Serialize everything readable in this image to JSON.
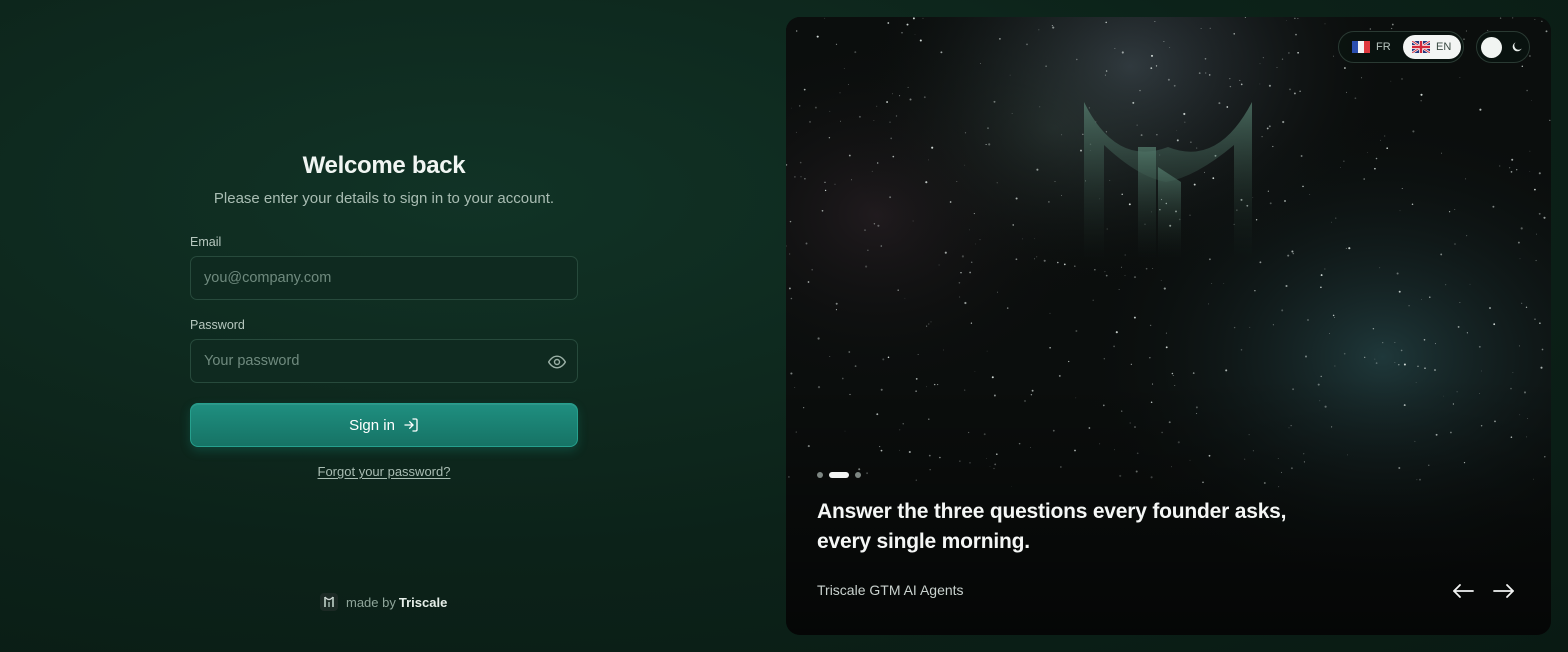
{
  "login": {
    "title": "Welcome back",
    "subtitle": "Please enter your details to sign in to your account.",
    "email": {
      "label": "Email",
      "placeholder": "you@company.com",
      "value": ""
    },
    "password": {
      "label": "Password",
      "placeholder": "Your password",
      "value": "",
      "toggle_icon": "eye-icon"
    },
    "signin_label": "Sign in",
    "signin_icon": "sign-in-arrow-icon",
    "forgot_label": "Forgot your password?"
  },
  "footer": {
    "made_by": "made by",
    "brand": "Triscale",
    "logo_icon": "triscale-logo-icon"
  },
  "hero": {
    "languages": [
      {
        "code": "FR",
        "flag": "france-flag-icon",
        "selected": false
      },
      {
        "code": "EN",
        "flag": "uk-flag-icon",
        "selected": true
      }
    ],
    "theme": {
      "mode": "dark",
      "icon": "moon-icon"
    },
    "carousel": {
      "slide_count": 3,
      "active_index": 1,
      "headline": "Answer the three questions every founder asks, every single morning.",
      "caption": "Triscale GTM AI Agents",
      "prev_icon": "arrow-left-icon",
      "next_icon": "arrow-right-icon"
    }
  },
  "colors": {
    "background": "#0c2219",
    "accent": "#1f8f80",
    "panel": "#0a0d0c",
    "text": "#f1f6f3"
  }
}
